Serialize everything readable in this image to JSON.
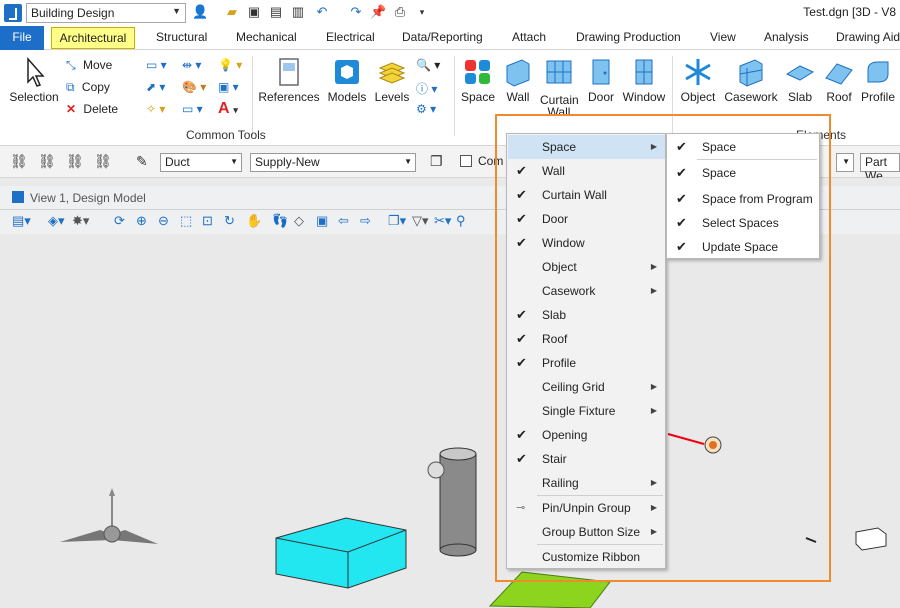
{
  "titlebar": {
    "workflow": "Building Design",
    "title": "Test.dgn [3D - V8"
  },
  "tabs": [
    "File",
    "Architectural",
    "Structural",
    "Mechanical",
    "Electrical",
    "Data/Reporting",
    "Attach",
    "Drawing Production",
    "View",
    "Analysis",
    "Drawing Aid"
  ],
  "ribbon": {
    "selection": "Selection",
    "move": "Move",
    "copy": "Copy",
    "delete": "Delete",
    "references": "References",
    "models": "Models",
    "levels": "Levels",
    "common_tools": "Common Tools",
    "space": "Space",
    "wall": "Wall",
    "curtain_wall_1": "Curtain",
    "curtain_wall_2": "Wall",
    "door": "Door",
    "window": "Window",
    "object": "Object",
    "casework": "Casework",
    "slab": "Slab",
    "roof": "Roof",
    "profile": "Profile",
    "group_partial": "Elements"
  },
  "toolbar2": {
    "duct": "Duct",
    "supply": "Supply-New",
    "com": "Com",
    "part": "Part We"
  },
  "view": {
    "title": "View 1, Design Model"
  },
  "menu": {
    "items": [
      {
        "label": "Space",
        "checked": false,
        "submenu": true,
        "highlight": true
      },
      {
        "label": "Wall",
        "checked": true,
        "submenu": false
      },
      {
        "label": "Curtain Wall",
        "checked": true,
        "submenu": false
      },
      {
        "label": "Door",
        "checked": true,
        "submenu": false
      },
      {
        "label": "Window",
        "checked": true,
        "submenu": false
      },
      {
        "label": "Object",
        "checked": false,
        "submenu": true
      },
      {
        "label": "Casework",
        "checked": false,
        "submenu": true
      },
      {
        "label": "Slab",
        "checked": true,
        "submenu": false
      },
      {
        "label": "Roof",
        "checked": true,
        "submenu": false
      },
      {
        "label": "Profile",
        "checked": true,
        "submenu": false
      },
      {
        "label": "Ceiling Grid",
        "checked": false,
        "submenu": true
      },
      {
        "label": "Single Fixture",
        "checked": false,
        "submenu": true
      },
      {
        "label": "Opening",
        "checked": true,
        "submenu": false
      },
      {
        "label": "Stair",
        "checked": true,
        "submenu": false
      },
      {
        "label": "Railing",
        "checked": false,
        "submenu": true
      },
      {
        "label": "Pin/Unpin Group",
        "checked": false,
        "submenu": true,
        "pin": true
      },
      {
        "label": "Group Button Size",
        "checked": false,
        "submenu": true
      },
      {
        "label": "Customize Ribbon",
        "checked": false,
        "submenu": false
      }
    ],
    "submenu_items": [
      {
        "label": "Space",
        "checked": true
      },
      {
        "label": "Space",
        "checked": true
      },
      {
        "label": "Space from Program",
        "checked": true
      },
      {
        "label": "Select Spaces",
        "checked": true
      },
      {
        "label": "Update Space",
        "checked": true
      }
    ]
  },
  "colors": {
    "accent": "#1c6ec8",
    "active_tab": "#ffff88",
    "highlight_border": "#f08a2e",
    "menu_highlight": "#cfe3f5",
    "cyan_box": "#22e6f0",
    "green_slab": "#8cd41e"
  }
}
